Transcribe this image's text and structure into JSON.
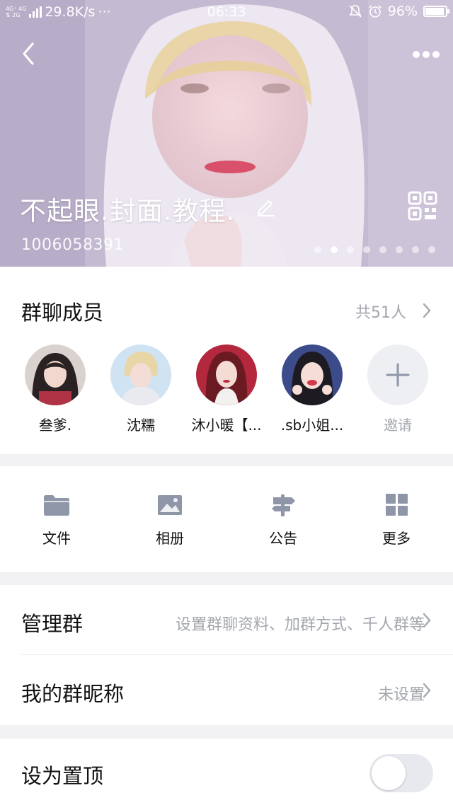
{
  "status_bar": {
    "signal_top": "4G⁺ 4G",
    "signal_bottom": "⇅ 2G",
    "speed": "29.8K/s",
    "ellipsis": "···",
    "time": "06:33",
    "battery_percent": "96%",
    "icons": [
      "mute-bell-icon",
      "alarm-icon",
      "battery-icon"
    ]
  },
  "header": {
    "back_icon": "chevron-left-icon",
    "more_icon": "more-dots-icon",
    "group_name": "不起眼.封面.教程.",
    "edit_icon": "pencil-icon",
    "qr_icon": "qr-code-icon",
    "group_id": "1006058391",
    "carousel": {
      "pages": 8,
      "active_index": 1
    }
  },
  "members": {
    "title": "群聊成员",
    "count_label": "共51人",
    "list": [
      {
        "name": "叁爹."
      },
      {
        "name": "沈糯"
      },
      {
        "name": "沐小暖【..."
      },
      {
        "name": ".sb小姐..."
      }
    ],
    "invite_label": "邀请"
  },
  "tools": [
    {
      "label": "文件",
      "icon": "folder-icon"
    },
    {
      "label": "相册",
      "icon": "image-icon"
    },
    {
      "label": "公告",
      "icon": "signpost-icon"
    },
    {
      "label": "更多",
      "icon": "grid-icon"
    }
  ],
  "settings": {
    "manage": {
      "label": "管理群",
      "value": "设置群聊资料、加群方式、千人群等"
    },
    "nickname": {
      "label": "我的群昵称",
      "value": "未设置"
    },
    "pin": {
      "label": "设为置顶",
      "enabled": false
    }
  },
  "colors": {
    "accent_grey": "#a3a6ad",
    "icon_grey": "#8e96a8",
    "hero_tint": "#c9bfd6"
  }
}
